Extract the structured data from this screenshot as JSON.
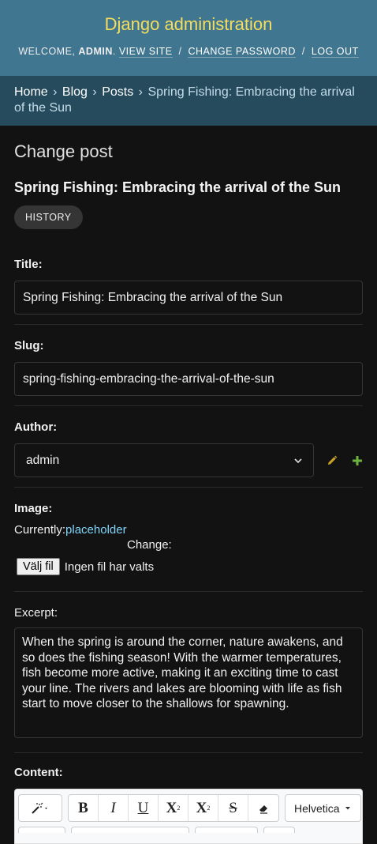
{
  "header": {
    "site_name": "Django administration",
    "welcome": "Welcome,",
    "username": "admin",
    "view_site": "View site",
    "change_password": "Change password",
    "log_out": "Log out",
    "separator": "/"
  },
  "breadcrumbs": {
    "home": "Home",
    "app": "Blog",
    "model": "Posts",
    "current": "Spring Fishing: Embracing the arrival of the Sun",
    "arrow": "›"
  },
  "page": {
    "title": "Change post",
    "object_title": "Spring Fishing: Embracing the arrival of the Sun",
    "history_button": "History"
  },
  "form": {
    "title": {
      "label": "Title:",
      "value": "Spring Fishing: Embracing the arrival of the Sun"
    },
    "slug": {
      "label": "Slug:",
      "value": "spring-fishing-embracing-the-arrival-of-the-sun"
    },
    "author": {
      "label": "Author:",
      "selected": "admin"
    },
    "image": {
      "label": "Image:",
      "currently_label": "Currently:",
      "current_file": "placeholder",
      "change_label": "Change:",
      "choose_button": "Välj fil",
      "no_file": "Ingen fil har valts"
    },
    "excerpt": {
      "label": "Excerpt:",
      "value": "When the spring is around the corner, nature awakens, and so does the fishing season! With the warmer temperatures, fish become more active, making it an exciting time to cast your line. The rivers and lakes are blooming with life as fish start to move closer to the shallows for spawning."
    },
    "content": {
      "label": "Content:",
      "toolbar": {
        "bold": "B",
        "italic": "I",
        "underline": "U",
        "superscript": "X",
        "subscript": "X",
        "strikethrough": "S",
        "font_name": "Helvetica"
      }
    }
  },
  "colors": {
    "header_bg": "#417690",
    "breadcrumb_bg": "#264b5d",
    "brand_yellow": "#f5dd5d",
    "body_bg": "#121212",
    "link_blue": "#81d4fa",
    "edit_icon": "#c9a227",
    "add_icon": "#6cb33e"
  }
}
